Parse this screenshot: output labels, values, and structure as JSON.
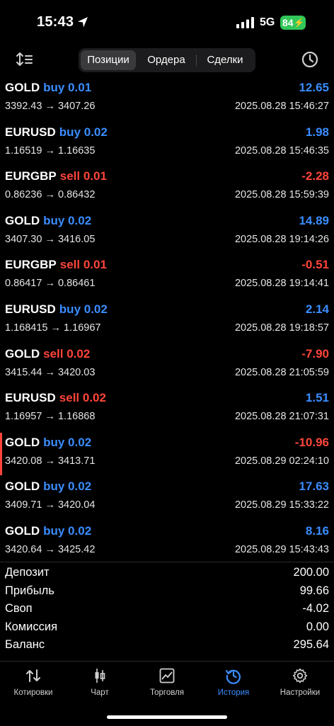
{
  "status_bar": {
    "time": "15:43",
    "network": "5G",
    "battery": "84"
  },
  "tabs_top": [
    {
      "label": "Позиции",
      "active": true
    },
    {
      "label": "Ордера",
      "active": false
    },
    {
      "label": "Сделки",
      "active": false
    }
  ],
  "deals": [
    {
      "symbol": "GOLD",
      "side": "buy 0.01",
      "prices": "3392.43 → 3407.26",
      "profit": "12.65",
      "date": "2025.08.28 15:46:27"
    },
    {
      "symbol": "EURUSD",
      "side": "buy 0.02",
      "prices": "1.16519 → 1.16635",
      "profit": "1.98",
      "date": "2025.08.28 15:46:35"
    },
    {
      "symbol": "EURGBP",
      "side": "sell 0.01",
      "prices": "0.86236 → 0.86432",
      "profit": "-2.28",
      "date": "2025.08.28 15:59:39"
    },
    {
      "symbol": "GOLD",
      "side": "buy 0.02",
      "prices": "3407.30 → 3416.05",
      "profit": "14.89",
      "date": "2025.08.28 19:14:26"
    },
    {
      "symbol": "EURGBP",
      "side": "sell 0.01",
      "prices": "0.86417 → 0.86461",
      "profit": "-0.51",
      "date": "2025.08.28 19:14:41"
    },
    {
      "symbol": "EURUSD",
      "side": "buy 0.02",
      "prices": "1.168415 → 1.16967",
      "profit": "2.14",
      "date": "2025.08.28 19:18:57"
    },
    {
      "symbol": "GOLD",
      "side": "sell 0.02",
      "prices": "3415.44 → 3420.03",
      "profit": "-7.90",
      "date": "2025.08.28 21:05:59"
    },
    {
      "symbol": "EURUSD",
      "side": "sell 0.02",
      "prices": "1.16957 → 1.16868",
      "profit": "1.51",
      "date": "2025.08.28 21:07:31"
    },
    {
      "symbol": "GOLD",
      "side": "buy 0.02",
      "prices": "3420.08 → 3413.71",
      "profit": "-10.96",
      "date": "2025.08.29 02:24:10"
    },
    {
      "symbol": "GOLD",
      "side": "buy 0.02",
      "prices": "3409.71 → 3420.04",
      "profit": "17.63",
      "date": "2025.08.29 15:33:22"
    },
    {
      "symbol": "GOLD",
      "side": "buy 0.02",
      "prices": "3420.64 → 3425.42",
      "profit": "8.16",
      "date": "2025.08.29 15:43:43"
    }
  ],
  "summary": [
    {
      "label": "Депозит",
      "value": "200.00"
    },
    {
      "label": "Прибыль",
      "value": "99.66"
    },
    {
      "label": "Своп",
      "value": "-4.02"
    },
    {
      "label": "Комиссия",
      "value": "0.00"
    },
    {
      "label": "Баланс",
      "value": "295.64"
    }
  ],
  "bottom_tabs": [
    {
      "label": "Котировки",
      "icon": "quotes-arrows-icon"
    },
    {
      "label": "Чарт",
      "icon": "candlestick-chart-icon"
    },
    {
      "label": "Торговля",
      "icon": "trade-chart-icon"
    },
    {
      "label": "История",
      "icon": "history-clock-icon",
      "active": true
    },
    {
      "label": "Настройки",
      "icon": "settings-gear-icon"
    }
  ],
  "colors": {
    "buy": "#3a8dff",
    "sell": "#ff453a",
    "accent": "#3a8dff",
    "background": "#000000"
  }
}
